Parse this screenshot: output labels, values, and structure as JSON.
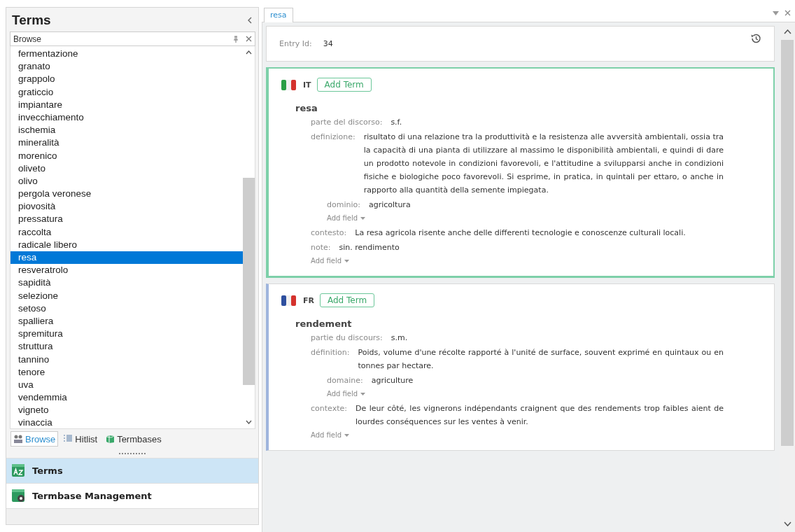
{
  "sidebar": {
    "title": "Terms",
    "browse_header": "Browse",
    "terms": [
      {
        "label": "fermentazione",
        "selected": false
      },
      {
        "label": "granato",
        "selected": false
      },
      {
        "label": "grappolo",
        "selected": false
      },
      {
        "label": "graticcio",
        "selected": false
      },
      {
        "label": "impiantare",
        "selected": false
      },
      {
        "label": "invecchiamento",
        "selected": false
      },
      {
        "label": "ischemia",
        "selected": false
      },
      {
        "label": "mineralità",
        "selected": false
      },
      {
        "label": "morenico",
        "selected": false
      },
      {
        "label": "oliveto",
        "selected": false
      },
      {
        "label": "olivo",
        "selected": false
      },
      {
        "label": "pergola veronese",
        "selected": false
      },
      {
        "label": "piovosità",
        "selected": false
      },
      {
        "label": "pressatura",
        "selected": false
      },
      {
        "label": "raccolta",
        "selected": false
      },
      {
        "label": "radicale libero",
        "selected": false
      },
      {
        "label": "resa",
        "selected": true
      },
      {
        "label": "resveratrolo",
        "selected": false
      },
      {
        "label": "sapidità",
        "selected": false
      },
      {
        "label": "selezione",
        "selected": false
      },
      {
        "label": "setoso",
        "selected": false
      },
      {
        "label": "spalliera",
        "selected": false
      },
      {
        "label": "spremitura",
        "selected": false
      },
      {
        "label": "struttura",
        "selected": false
      },
      {
        "label": "tannino",
        "selected": false
      },
      {
        "label": "tenore",
        "selected": false
      },
      {
        "label": "uva",
        "selected": false
      },
      {
        "label": "vendemmia",
        "selected": false
      },
      {
        "label": "vigneto",
        "selected": false
      },
      {
        "label": "vinaccia",
        "selected": false
      }
    ],
    "tabs": [
      {
        "label": "Browse",
        "selected": true
      },
      {
        "label": "Hitlist",
        "selected": false
      },
      {
        "label": "Termbases",
        "selected": false
      }
    ],
    "nav": [
      {
        "label": "Terms",
        "selected": true
      },
      {
        "label": "Termbase Management",
        "selected": false
      }
    ]
  },
  "document_tabs": [
    {
      "label": "resa",
      "selected": true
    }
  ],
  "entry": {
    "id_label": "Entry Id:",
    "id": "34"
  },
  "languages": [
    {
      "code": "IT",
      "color": "#7dd0a9",
      "selected": true,
      "add_term": "Add Term",
      "term": "resa",
      "fields": [
        {
          "kind": "field",
          "label": "parte del discorso:",
          "value": "s.f."
        },
        {
          "kind": "field",
          "label": "definizione:",
          "value": "risultato di una relazione tra la produttività e la resistenza alle avversità ambientali, ossia tra la capacità di una pianta di utilizzare al massimo le disponibilità ambientali, e quindi di dare un prodotto notevole in condizioni favorevoli, e l'attitudine a svilupparsi anche in condizioni fisiche e biologiche poco favorevoli. Si esprime, in pratica, in quintali per ettaro, o anche in rapporto alla quantità della semente impiegata.",
          "children": [
            {
              "kind": "field",
              "label": "dominio:",
              "value": "agricoltura"
            },
            {
              "kind": "add",
              "label": "Add field"
            }
          ]
        },
        {
          "kind": "field",
          "label": "contesto:",
          "value": "La resa agricola risente anche delle differenti tecnologie e conoscenze culturali locali."
        },
        {
          "kind": "field",
          "label": "note:",
          "value": "sin. rendimento"
        },
        {
          "kind": "add",
          "label": "Add field"
        }
      ]
    },
    {
      "code": "FR",
      "color": "#9fb5dd",
      "selected": false,
      "add_term": "Add Term",
      "term": "rendement",
      "fields": [
        {
          "kind": "field",
          "label": "partie du discours:",
          "value": "s.m."
        },
        {
          "kind": "field",
          "label": "définition:",
          "value": "Poids, volume d'une récolte rapporté à l'unité de surface, souvent exprimé en quintaux ou en tonnes par hectare.",
          "children": [
            {
              "kind": "field",
              "label": "domaine:",
              "value": "agriculture"
            },
            {
              "kind": "add",
              "label": "Add field"
            }
          ]
        },
        {
          "kind": "field",
          "label": "contexte:",
          "value": "De leur côté, les vignerons indépendants craignent que des rendements trop faibles aient de lourdes conséquences sur les ventes à venir."
        },
        {
          "kind": "add",
          "label": "Add field"
        }
      ]
    }
  ]
}
